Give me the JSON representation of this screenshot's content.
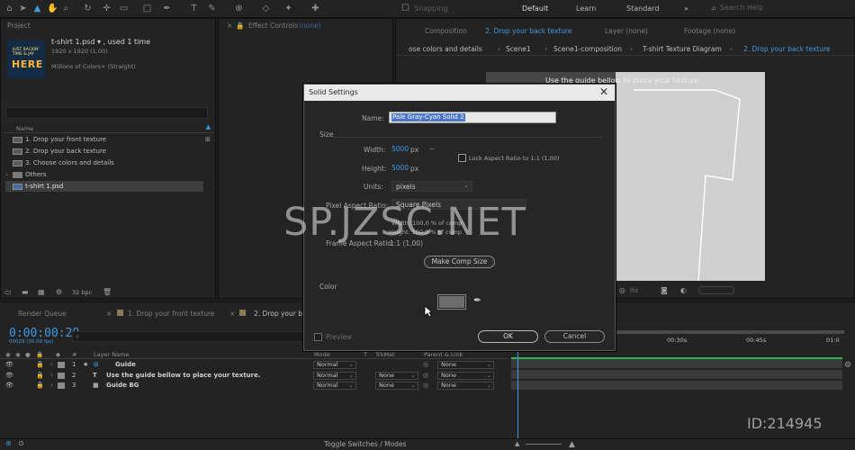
{
  "toolbar": {
    "snapping_label": "Snapping",
    "workspaces": [
      "Default",
      "Learn",
      "Standard"
    ],
    "search_placeholder": "Search Help"
  },
  "project": {
    "tab_label": "Project",
    "item_name": "t-shirt 1.psd",
    "item_used": ", used 1 time",
    "item_dimensions": "1920 x 1920 (1,00)",
    "item_colors": "Millions of Colors+ (Straight)",
    "thumb_line1": "JUST BACKIN' TIME & JAY",
    "thumb_line2": "HERE",
    "column_name": "Name",
    "rows": [
      {
        "label": "1. Drop your front texture",
        "kind": "comp"
      },
      {
        "label": "2. Drop your back texture",
        "kind": "comp"
      },
      {
        "label": "3. Choose colors and details",
        "kind": "comp"
      },
      {
        "label": "Others",
        "kind": "folder"
      },
      {
        "label": "t-shirt 1.psd",
        "kind": "file",
        "selected": true
      }
    ],
    "bpc": "32 bpc"
  },
  "effects": {
    "tab_label": "Effect Controls",
    "tab_value": "(none)"
  },
  "composition": {
    "tab_label": "Composition",
    "tab_active": "2. Drop your back texture",
    "layer_tab": "Layer (none)",
    "footage_tab": "Footage (none)",
    "crumbs": [
      "ose colors and details",
      "Scene1",
      "Scene1-composition",
      "T-shirt Texture Diagram",
      "2. Drop your back texture"
    ],
    "canvas_hint": "Use the guide bellow to place your texture."
  },
  "timeline": {
    "tabs": [
      "Render Queue",
      "1. Drop your front texture",
      "2. Drop your back texture"
    ],
    "timecode": "0:00:00:29",
    "fps": "00029 (30.00 fps)",
    "headers": {
      "layer_name": "Layer Name",
      "mode": "Mode",
      "t": "T",
      "trkmat": "TrkMat",
      "parent": "Parent & Link"
    },
    "ruler_labels": [
      "00:30s",
      "00:45s",
      "01:0"
    ],
    "layers": [
      {
        "num": "1",
        "icon": "★",
        "name": "Guide",
        "swatch": "#8c8c8c",
        "mode": "Normal",
        "trkmat": "",
        "parent": "None"
      },
      {
        "num": "2",
        "icon": "T",
        "name": "Use the guide bellow to place your texture.",
        "swatch": "#8c8c8c",
        "mode": "Normal",
        "trkmat": "None",
        "parent": "None"
      },
      {
        "num": "3",
        "icon": "■",
        "name": "Guide BG",
        "swatch": "#8c8c8c",
        "mode": "Normal",
        "trkmat": "None",
        "parent": "None"
      }
    ]
  },
  "status": {
    "toggle_label": "Toggle Switches / Modes"
  },
  "dialog": {
    "title": "Solid Settings",
    "name_label": "Name:",
    "name_value": "Pale Gray-Cyan Solid 2",
    "size_section": "Size",
    "width_label": "Width:",
    "width_value": "5000",
    "width_unit": "px",
    "height_label": "Height:",
    "height_value": "5000",
    "height_unit": "px",
    "lock_label": "Lock Aspect Ratio to 1:1 (1,00)",
    "units_label": "Units:",
    "units_value": "pixels",
    "pixel_aspect_label": "Pixel Aspect Ratio:",
    "pixel_aspect_value": "Square Pixels",
    "width_pct": "Width: 100,0 % of comp",
    "height_pct": "Height: 100,0 % of comp",
    "frame_aspect_label": "Frame Aspect Ratio:",
    "frame_aspect_value": "1:1 (1,00)",
    "make_comp_size": "Make Comp Size",
    "color_section": "Color",
    "swatch_color": "#6d6d6d",
    "preview_label": "Preview",
    "ok_label": "OK",
    "cancel_label": "Cancel"
  },
  "watermark": {
    "main": "SP.JZSC.NET",
    "id": "ID:214945"
  },
  "colors": {
    "accent_blue": "#3f9ae0",
    "panel_bg": "#232323",
    "track_green": "#34b24a"
  }
}
